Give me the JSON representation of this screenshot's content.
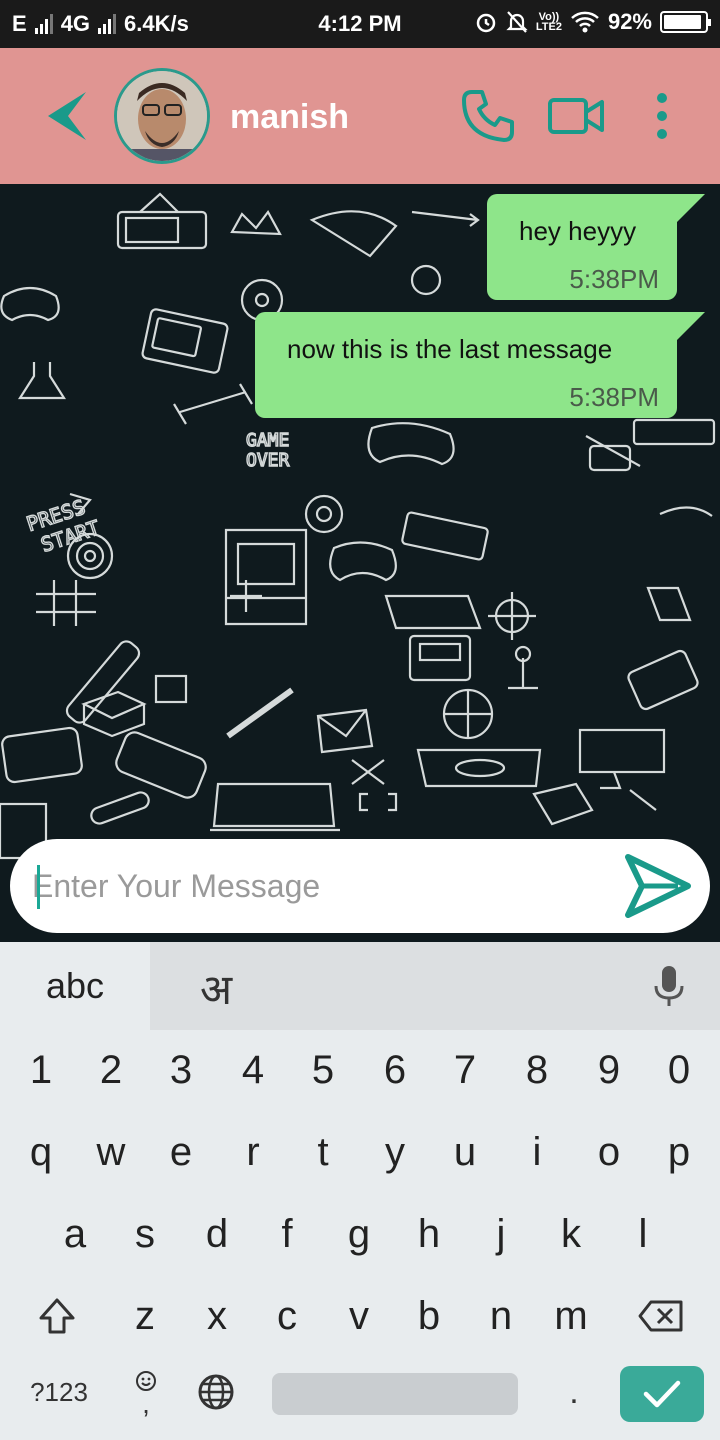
{
  "status_bar": {
    "carrier_left": "E",
    "network": "4G",
    "speed": "6.4K/s",
    "time": "4:12 PM",
    "volte_top": "Vo))",
    "volte_bottom": "LTE2",
    "battery": "92%",
    "battery_level": 0.92
  },
  "header": {
    "contact_name": "manish",
    "icons": [
      "back-arrow-icon",
      "phone-icon",
      "video-camera-icon",
      "more-vert-icon"
    ],
    "accent_color": "#1a9a8a",
    "bar_color": "#e09592"
  },
  "messages": [
    {
      "text": "hey heyyy",
      "time": "5:38PM"
    },
    {
      "text": "now this is the last message",
      "time": "5:38PM"
    }
  ],
  "composer": {
    "placeholder": "Enter Your Message",
    "send_icon": "send-icon"
  },
  "keyboard": {
    "mode_label": "abc",
    "language_label": "अ",
    "number_row": [
      "1",
      "2",
      "3",
      "4",
      "5",
      "6",
      "7",
      "8",
      "9",
      "0"
    ],
    "row1": [
      "q",
      "w",
      "e",
      "r",
      "t",
      "y",
      "u",
      "i",
      "o",
      "p"
    ],
    "row2": [
      "a",
      "s",
      "d",
      "f",
      "g",
      "h",
      "j",
      "k",
      "l"
    ],
    "row3": [
      "z",
      "x",
      "c",
      "v",
      "b",
      "n",
      "m"
    ],
    "symbols_label": "?123",
    "period_label": ".",
    "comma_label": ","
  }
}
